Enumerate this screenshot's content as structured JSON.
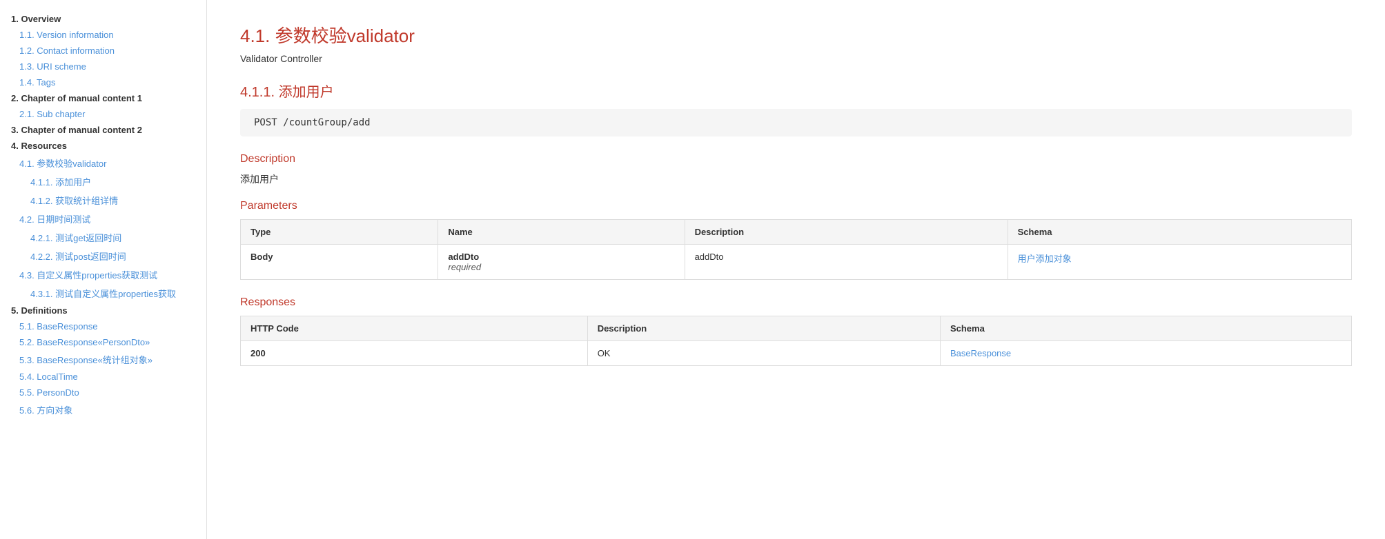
{
  "sidebar": {
    "items": [
      {
        "id": "item-1",
        "label": "1. Overview",
        "level": "level-1"
      },
      {
        "id": "item-1-1",
        "label": "1.1. Version information",
        "level": "level-2"
      },
      {
        "id": "item-1-2",
        "label": "1.2. Contact information",
        "level": "level-2"
      },
      {
        "id": "item-1-3",
        "label": "1.3. URI scheme",
        "level": "level-2"
      },
      {
        "id": "item-1-4",
        "label": "1.4. Tags",
        "level": "level-2"
      },
      {
        "id": "item-2",
        "label": "2. Chapter of manual content 1",
        "level": "level-1"
      },
      {
        "id": "item-2-1",
        "label": "2.1. Sub chapter",
        "level": "level-2"
      },
      {
        "id": "item-3",
        "label": "3. Chapter of manual content 2",
        "level": "level-1"
      },
      {
        "id": "item-4",
        "label": "4. Resources",
        "level": "level-1"
      },
      {
        "id": "item-4-1",
        "label": "4.1. 参数校验validator",
        "level": "level-2"
      },
      {
        "id": "item-4-1-1",
        "label": "4.1.1. 添加用户",
        "level": "level-3"
      },
      {
        "id": "item-4-1-2",
        "label": "4.1.2. 获取统计组详情",
        "level": "level-3"
      },
      {
        "id": "item-4-2",
        "label": "4.2. 日期时间测试",
        "level": "level-2"
      },
      {
        "id": "item-4-2-1",
        "label": "4.2.1. 测试get返回时间",
        "level": "level-3"
      },
      {
        "id": "item-4-2-2",
        "label": "4.2.2. 测试post返回时间",
        "level": "level-3"
      },
      {
        "id": "item-4-3",
        "label": "4.3. 自定义属性properties获取测试",
        "level": "level-2"
      },
      {
        "id": "item-4-3-1",
        "label": "4.3.1. 测试自定义属性properties获取",
        "level": "level-3"
      },
      {
        "id": "item-5",
        "label": "5. Definitions",
        "level": "level-1"
      },
      {
        "id": "item-5-1",
        "label": "5.1. BaseResponse",
        "level": "level-2"
      },
      {
        "id": "item-5-2",
        "label": "5.2. BaseResponse«PersonDto»",
        "level": "level-2"
      },
      {
        "id": "item-5-3",
        "label": "5.3. BaseResponse«统计组对象»",
        "level": "level-2"
      },
      {
        "id": "item-5-4",
        "label": "5.4. LocalTime",
        "level": "level-2"
      },
      {
        "id": "item-5-5",
        "label": "5.5. PersonDto",
        "level": "level-2"
      },
      {
        "id": "item-5-6",
        "label": "5.6. 方向对象",
        "level": "level-2"
      }
    ]
  },
  "main": {
    "section_title": "4.1. 参数校验validator",
    "subtitle": "Validator Controller",
    "subsection_title": "4.1.1. 添加用户",
    "code": "POST /countGroup/add",
    "description_label": "Description",
    "description_text": "添加用户",
    "parameters_label": "Parameters",
    "parameters_table": {
      "columns": [
        "Type",
        "Name",
        "Description",
        "Schema"
      ],
      "rows": [
        {
          "type": "Body",
          "name": "addDto",
          "name_sub": "required",
          "description": "addDto",
          "schema": "用户添加对象",
          "schema_link": true
        }
      ]
    },
    "responses_label": "Responses",
    "responses_table": {
      "columns": [
        "HTTP Code",
        "Description",
        "Schema"
      ],
      "rows": [
        {
          "code": "200",
          "description": "OK",
          "schema": "BaseResponse",
          "schema_link": true
        }
      ]
    }
  }
}
